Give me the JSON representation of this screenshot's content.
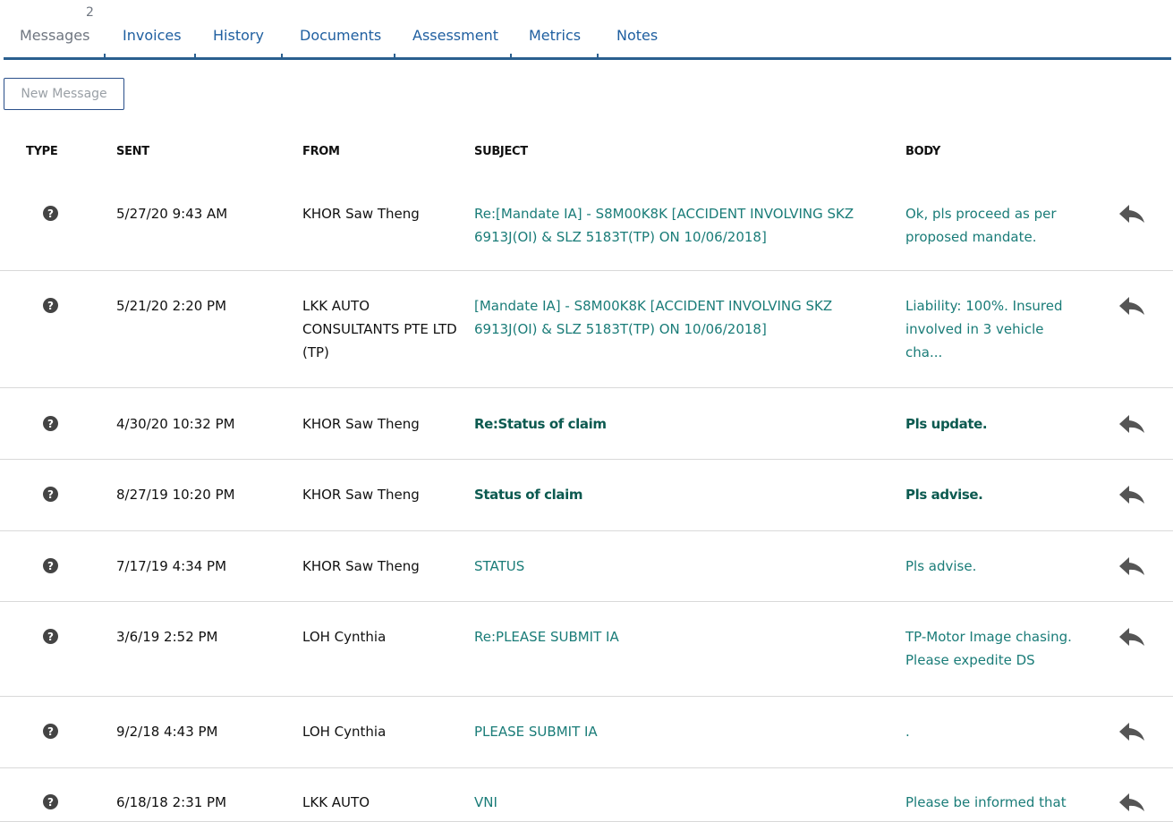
{
  "tabs": [
    {
      "label": "Messages",
      "count": "2",
      "active": true
    },
    {
      "label": "Invoices"
    },
    {
      "label": "History"
    },
    {
      "label": "Documents"
    },
    {
      "label": "Assessment"
    },
    {
      "label": "Metrics"
    },
    {
      "label": "Notes"
    }
  ],
  "toolbar": {
    "new_message_label": "New Message"
  },
  "table": {
    "headers": {
      "type": "TYPE",
      "sent": "SENT",
      "from": "FROM",
      "subject": "SUBJECT",
      "body": "BODY"
    },
    "rows": [
      {
        "type_icon": "question-circle-icon",
        "sent": "5/27/20 9:43 AM",
        "from": "KHOR Saw Theng",
        "subject": "Re:[Mandate IA] - S8M00K8K [ACCIDENT INVOLVING SKZ 6913J(OI) & SLZ 5183T(TP) ON 10/06/2018]",
        "body": "Ok, pls proceed as per proposed mandate.",
        "unread": false
      },
      {
        "type_icon": "question-circle-icon",
        "sent": "5/21/20 2:20 PM",
        "from": "LKK AUTO CONSULTANTS PTE LTD (TP)",
        "subject": "[Mandate IA] - S8M00K8K [ACCIDENT INVOLVING SKZ 6913J(OI) & SLZ 5183T(TP) ON 10/06/2018]",
        "body": "Liability: 100%. Insured involved in 3 vehicle cha...",
        "unread": false
      },
      {
        "type_icon": "question-circle-icon",
        "sent": "4/30/20 10:32 PM",
        "from": "KHOR Saw Theng",
        "subject": "Re:Status of claim",
        "body": "Pls update.",
        "unread": true
      },
      {
        "type_icon": "question-circle-icon",
        "sent": "8/27/19 10:20 PM",
        "from": "KHOR Saw Theng",
        "subject": "Status of claim",
        "body": "Pls advise.",
        "unread": true
      },
      {
        "type_icon": "question-circle-icon",
        "sent": "7/17/19 4:34 PM",
        "from": "KHOR Saw Theng",
        "subject": "STATUS",
        "body": "Pls advise.",
        "unread": false
      },
      {
        "type_icon": "question-circle-icon",
        "sent": "3/6/19 2:52 PM",
        "from": "LOH Cynthia",
        "subject": "Re:PLEASE SUBMIT IA",
        "body": "TP-Motor Image chasing. Please expedite DS",
        "unread": false
      },
      {
        "type_icon": "question-circle-icon",
        "sent": "9/2/18 4:43 PM",
        "from": "LOH Cynthia",
        "subject": "PLEASE SUBMIT IA",
        "body": ".",
        "unread": false
      },
      {
        "type_icon": "question-circle-icon",
        "sent": "6/18/18 2:31 PM",
        "from": "LKK AUTO",
        "subject": "VNI",
        "body": "Please be informed that",
        "unread": false
      }
    ]
  },
  "colors": {
    "accent": "#2a5f8f",
    "link": "#1a7c78",
    "link_bold": "#0c5a50",
    "icon": "#555555"
  },
  "reply_icon": "reply-arrow-icon"
}
